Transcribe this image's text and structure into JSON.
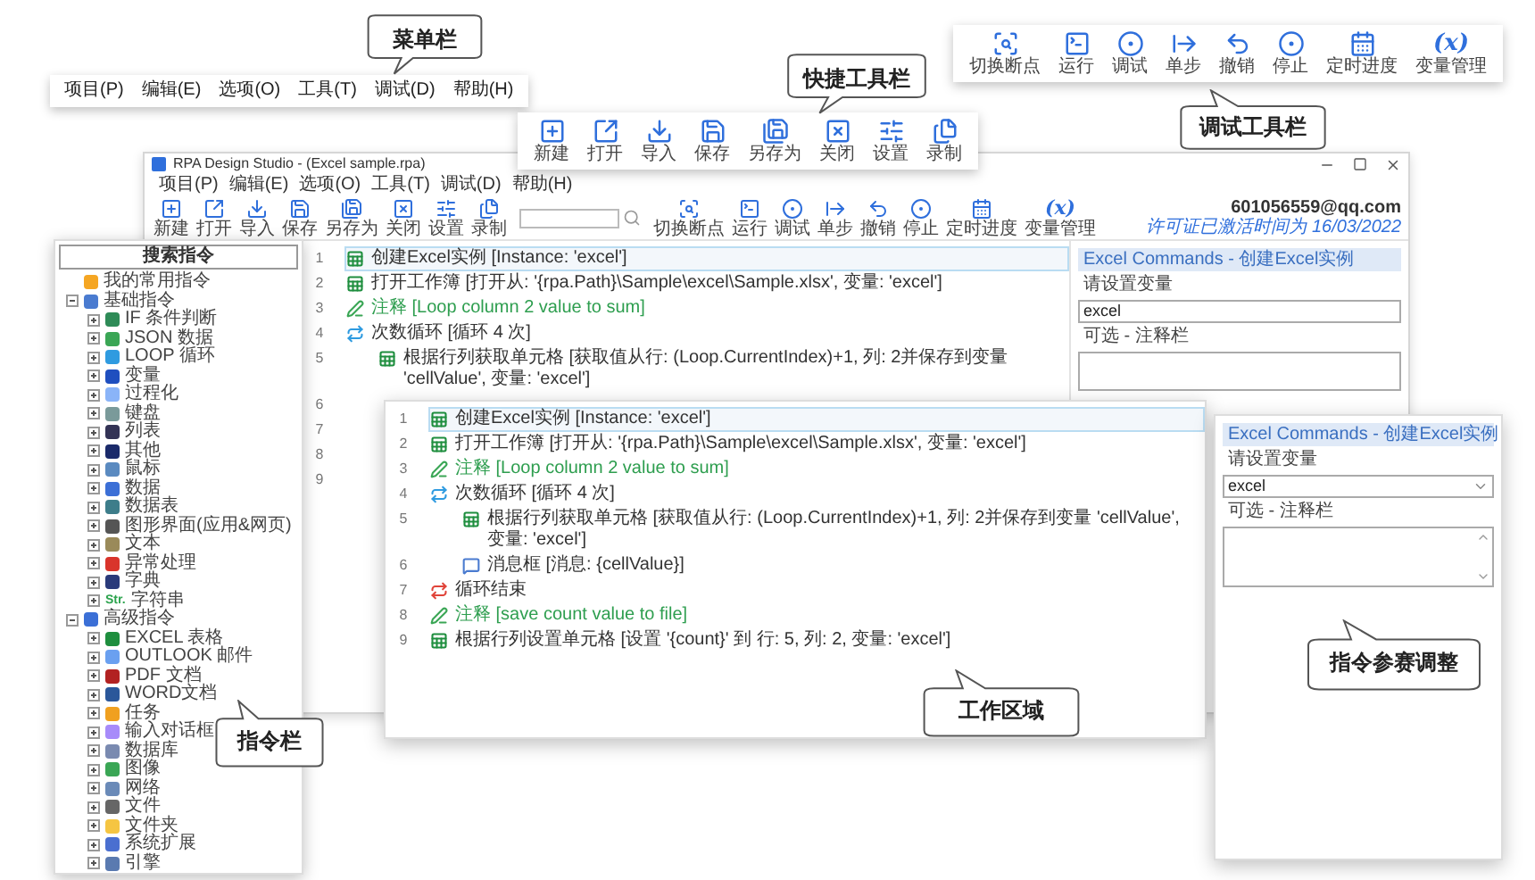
{
  "menu_callout": {
    "label": "菜单栏"
  },
  "menu_bar": {
    "items": [
      "项目(P)",
      "编辑(E)",
      "选项(O)",
      "工具(T)",
      "调试(D)",
      "帮助(H)"
    ]
  },
  "quick_toolbar_callout": {
    "label": "快捷工具栏"
  },
  "quick_toolbar": {
    "buttons": [
      {
        "label": "新建",
        "kind": "new"
      },
      {
        "label": "打开",
        "kind": "open"
      },
      {
        "label": "导入",
        "kind": "import"
      },
      {
        "label": "保存",
        "kind": "save"
      },
      {
        "label": "另存为",
        "kind": "saveas"
      },
      {
        "label": "关闭",
        "kind": "close"
      },
      {
        "label": "设置",
        "kind": "settings"
      },
      {
        "label": "录制",
        "kind": "record"
      }
    ]
  },
  "debug_toolbar": {
    "buttons": [
      {
        "label": "切换断点",
        "kind": "breakpoint"
      },
      {
        "label": "运行",
        "kind": "run"
      },
      {
        "label": "调试",
        "kind": "debug"
      },
      {
        "label": "单步",
        "kind": "step"
      },
      {
        "label": "撤销",
        "kind": "undo"
      },
      {
        "label": "停止",
        "kind": "stop"
      },
      {
        "label": "定时进度",
        "kind": "schedule"
      },
      {
        "label": "变量管理",
        "kind": "variables",
        "glyph": "(x)"
      }
    ]
  },
  "debug_toolbar_callout": {
    "label": "调试工具栏"
  },
  "window": {
    "title": "RPA Design Studio - (Excel sample.rpa)",
    "menu": [
      "项目(P)",
      "编辑(E)",
      "选项(O)",
      "工具(T)",
      "调试(D)",
      "帮助(H)"
    ],
    "file_buttons": [
      {
        "label": "新建",
        "kind": "new"
      },
      {
        "label": "打开",
        "kind": "open"
      },
      {
        "label": "导入",
        "kind": "import"
      },
      {
        "label": "保存",
        "kind": "save"
      },
      {
        "label": "另存为",
        "kind": "saveas"
      },
      {
        "label": "关闭",
        "kind": "close"
      },
      {
        "label": "设置",
        "kind": "settings"
      },
      {
        "label": "录制",
        "kind": "record"
      }
    ],
    "debug_buttons": [
      {
        "label": "切换断点",
        "kind": "breakpoint"
      },
      {
        "label": "运行",
        "kind": "run"
      },
      {
        "label": "调试",
        "kind": "debug"
      },
      {
        "label": "单步",
        "kind": "step"
      },
      {
        "label": "撤销",
        "kind": "undo"
      },
      {
        "label": "停止",
        "kind": "stop"
      },
      {
        "label": "定时进度",
        "kind": "schedule"
      },
      {
        "label": "变量管理",
        "kind": "variables",
        "glyph": "(x)"
      }
    ],
    "account": "601056559@qq.com",
    "license": "许可证已激活时间为 16/03/2022",
    "editor": {
      "lines": [
        {
          "number": "1",
          "text": "创建Excel实例 [Instance: 'excel']",
          "kind": "excel",
          "selected": true
        },
        {
          "number": "2",
          "text": "打开工作簿 [打开从: '{rpa.Path}\\Sample\\excel\\Sample.xlsx', 变量: 'excel']",
          "kind": "excel",
          "selected": false
        },
        {
          "number": "3",
          "text": "注释 [Loop column 2 value to sum]",
          "kind": "comment",
          "selected": false
        },
        {
          "number": "4",
          "text": "次数循环 [循环 4 次]",
          "kind": "loop",
          "selected": false,
          "children": [
            {
              "number": "5",
              "text": "根据行列获取单元格 [获取值从行: (Loop.CurrentIndex)+1, 列: 2并保存到变量 'cellValue', 变量: 'excel']",
              "kind": "excel",
              "selected": false
            },
            {
              "number": "6"
            }
          ]
        },
        {
          "number": "7"
        },
        {
          "number": "8"
        },
        {
          "number": "9"
        }
      ]
    },
    "properties": {
      "header": "Excel Commands - 创建Excel实例",
      "variable_label": "请设置变量",
      "variable_value": "excel",
      "comment_label": "可选 - 注释栏"
    }
  },
  "sidebar": {
    "title": "搜索指令",
    "tree": [
      {
        "label": "我的常用指令",
        "color": "#f5a623"
      },
      {
        "label": "基础指令",
        "color": "#4a7bd0",
        "expanded": true,
        "children": [
          {
            "label": "IF 条件判断",
            "color": "#2e8b57",
            "expanded": false
          },
          {
            "label": "JSON 数据",
            "color": "#3aa655",
            "expanded": false
          },
          {
            "label": "LOOP 循环",
            "color": "#2f9be0",
            "expanded": false
          },
          {
            "label": "变量",
            "color": "#1f4fbf",
            "expanded": false
          },
          {
            "label": "过程化",
            "color": "#8ab4f8",
            "expanded": false
          },
          {
            "label": "键盘",
            "color": "#7a9a9a",
            "expanded": false
          },
          {
            "label": "列表",
            "color": "#333355",
            "expanded": false
          },
          {
            "label": "其他",
            "color": "#1a2a6a",
            "expanded": false
          },
          {
            "label": "鼠标",
            "color": "#5a8ac0",
            "expanded": false
          },
          {
            "label": "数据",
            "color": "#3b6fd6",
            "expanded": false
          },
          {
            "label": "数据表",
            "color": "#3d7d8a",
            "expanded": false
          },
          {
            "label": "图形界面(应用&网页)",
            "color": "#555555",
            "expanded": false
          },
          {
            "label": "文本",
            "color": "#9a8a5a",
            "expanded": false
          },
          {
            "label": "异常处理",
            "color": "#d9342b",
            "expanded": false
          },
          {
            "label": "字典",
            "color": "#2a3a7a",
            "expanded": false
          },
          {
            "label": "字符串",
            "color": "#2ea44f",
            "glyph": "Str.",
            "expanded": false
          }
        ]
      },
      {
        "label": "高级指令",
        "color": "#3b6fd6",
        "expanded": true,
        "children": [
          {
            "label": "EXCEL 表格",
            "color": "#1e8e3e",
            "expanded": false
          },
          {
            "label": "OUTLOOK 邮件",
            "color": "#6aa0f0",
            "expanded": false
          },
          {
            "label": "PDF 文档",
            "color": "#b22222",
            "expanded": false
          },
          {
            "label": "WORD文档",
            "color": "#2b579a",
            "expanded": false
          },
          {
            "label": "任务",
            "color": "#f0a020",
            "expanded": false
          },
          {
            "label": "输入对话框",
            "color": "#a78bfa",
            "expanded": false
          },
          {
            "label": "数据库",
            "color": "#7a8ab0",
            "expanded": false
          },
          {
            "label": "图像",
            "color": "#3aa655",
            "expanded": false
          },
          {
            "label": "网络",
            "color": "#6a8ab8",
            "expanded": false
          },
          {
            "label": "文件",
            "color": "#666666",
            "expanded": false
          },
          {
            "label": "文件夹",
            "color": "#f5c542",
            "expanded": false
          },
          {
            "label": "系统扩展",
            "color": "#4a6fd0",
            "expanded": false
          },
          {
            "label": "引擎",
            "color": "#5a7ab0",
            "expanded": false
          }
        ]
      }
    ]
  },
  "sidebar_callout": {
    "label": "指令栏"
  },
  "work_area_zoom": {
    "lines": [
      {
        "number": "1",
        "text": "创建Excel实例 [Instance: 'excel']",
        "kind": "excel",
        "selected": true
      },
      {
        "number": "2",
        "text": "打开工作簿 [打开从: '{rpa.Path}\\Sample\\excel\\Sample.xlsx', 变量: 'excel']",
        "kind": "excel",
        "selected": false
      },
      {
        "number": "3",
        "text": "注释 [Loop column 2 value to sum]",
        "kind": "comment",
        "selected": false
      },
      {
        "number": "4",
        "text": "次数循环 [循环 4 次]",
        "kind": "loop",
        "selected": false,
        "children": [
          {
            "number": "5",
            "text": "根据行列获取单元格 [获取值从行: (Loop.CurrentIndex)+1, 列: 2并保存到变量 'cellValue', 变量: 'excel']",
            "kind": "excel",
            "selected": false
          },
          {
            "number": "6",
            "text": "消息框 [消息: {cellValue}]",
            "kind": "message",
            "selected": false
          }
        ]
      },
      {
        "number": "7",
        "text": "循环结束",
        "kind": "loopend",
        "selected": false
      },
      {
        "number": "8",
        "text": "注释 [save count value to file]",
        "kind": "comment",
        "selected": false
      },
      {
        "number": "9",
        "text": "根据行列设置单元格 [设置 '{count}' 到 行: 5, 列: 2, 变量: 'excel']",
        "kind": "excel",
        "selected": false
      }
    ],
    "callout": "工作区域"
  },
  "properties_zoom": {
    "header": "Excel Commands - 创建Excel实例",
    "variable_label": "请设置变量",
    "variable_value": "excel",
    "comment_label": "可选 - 注释栏",
    "callout": "指令参赛调整"
  }
}
